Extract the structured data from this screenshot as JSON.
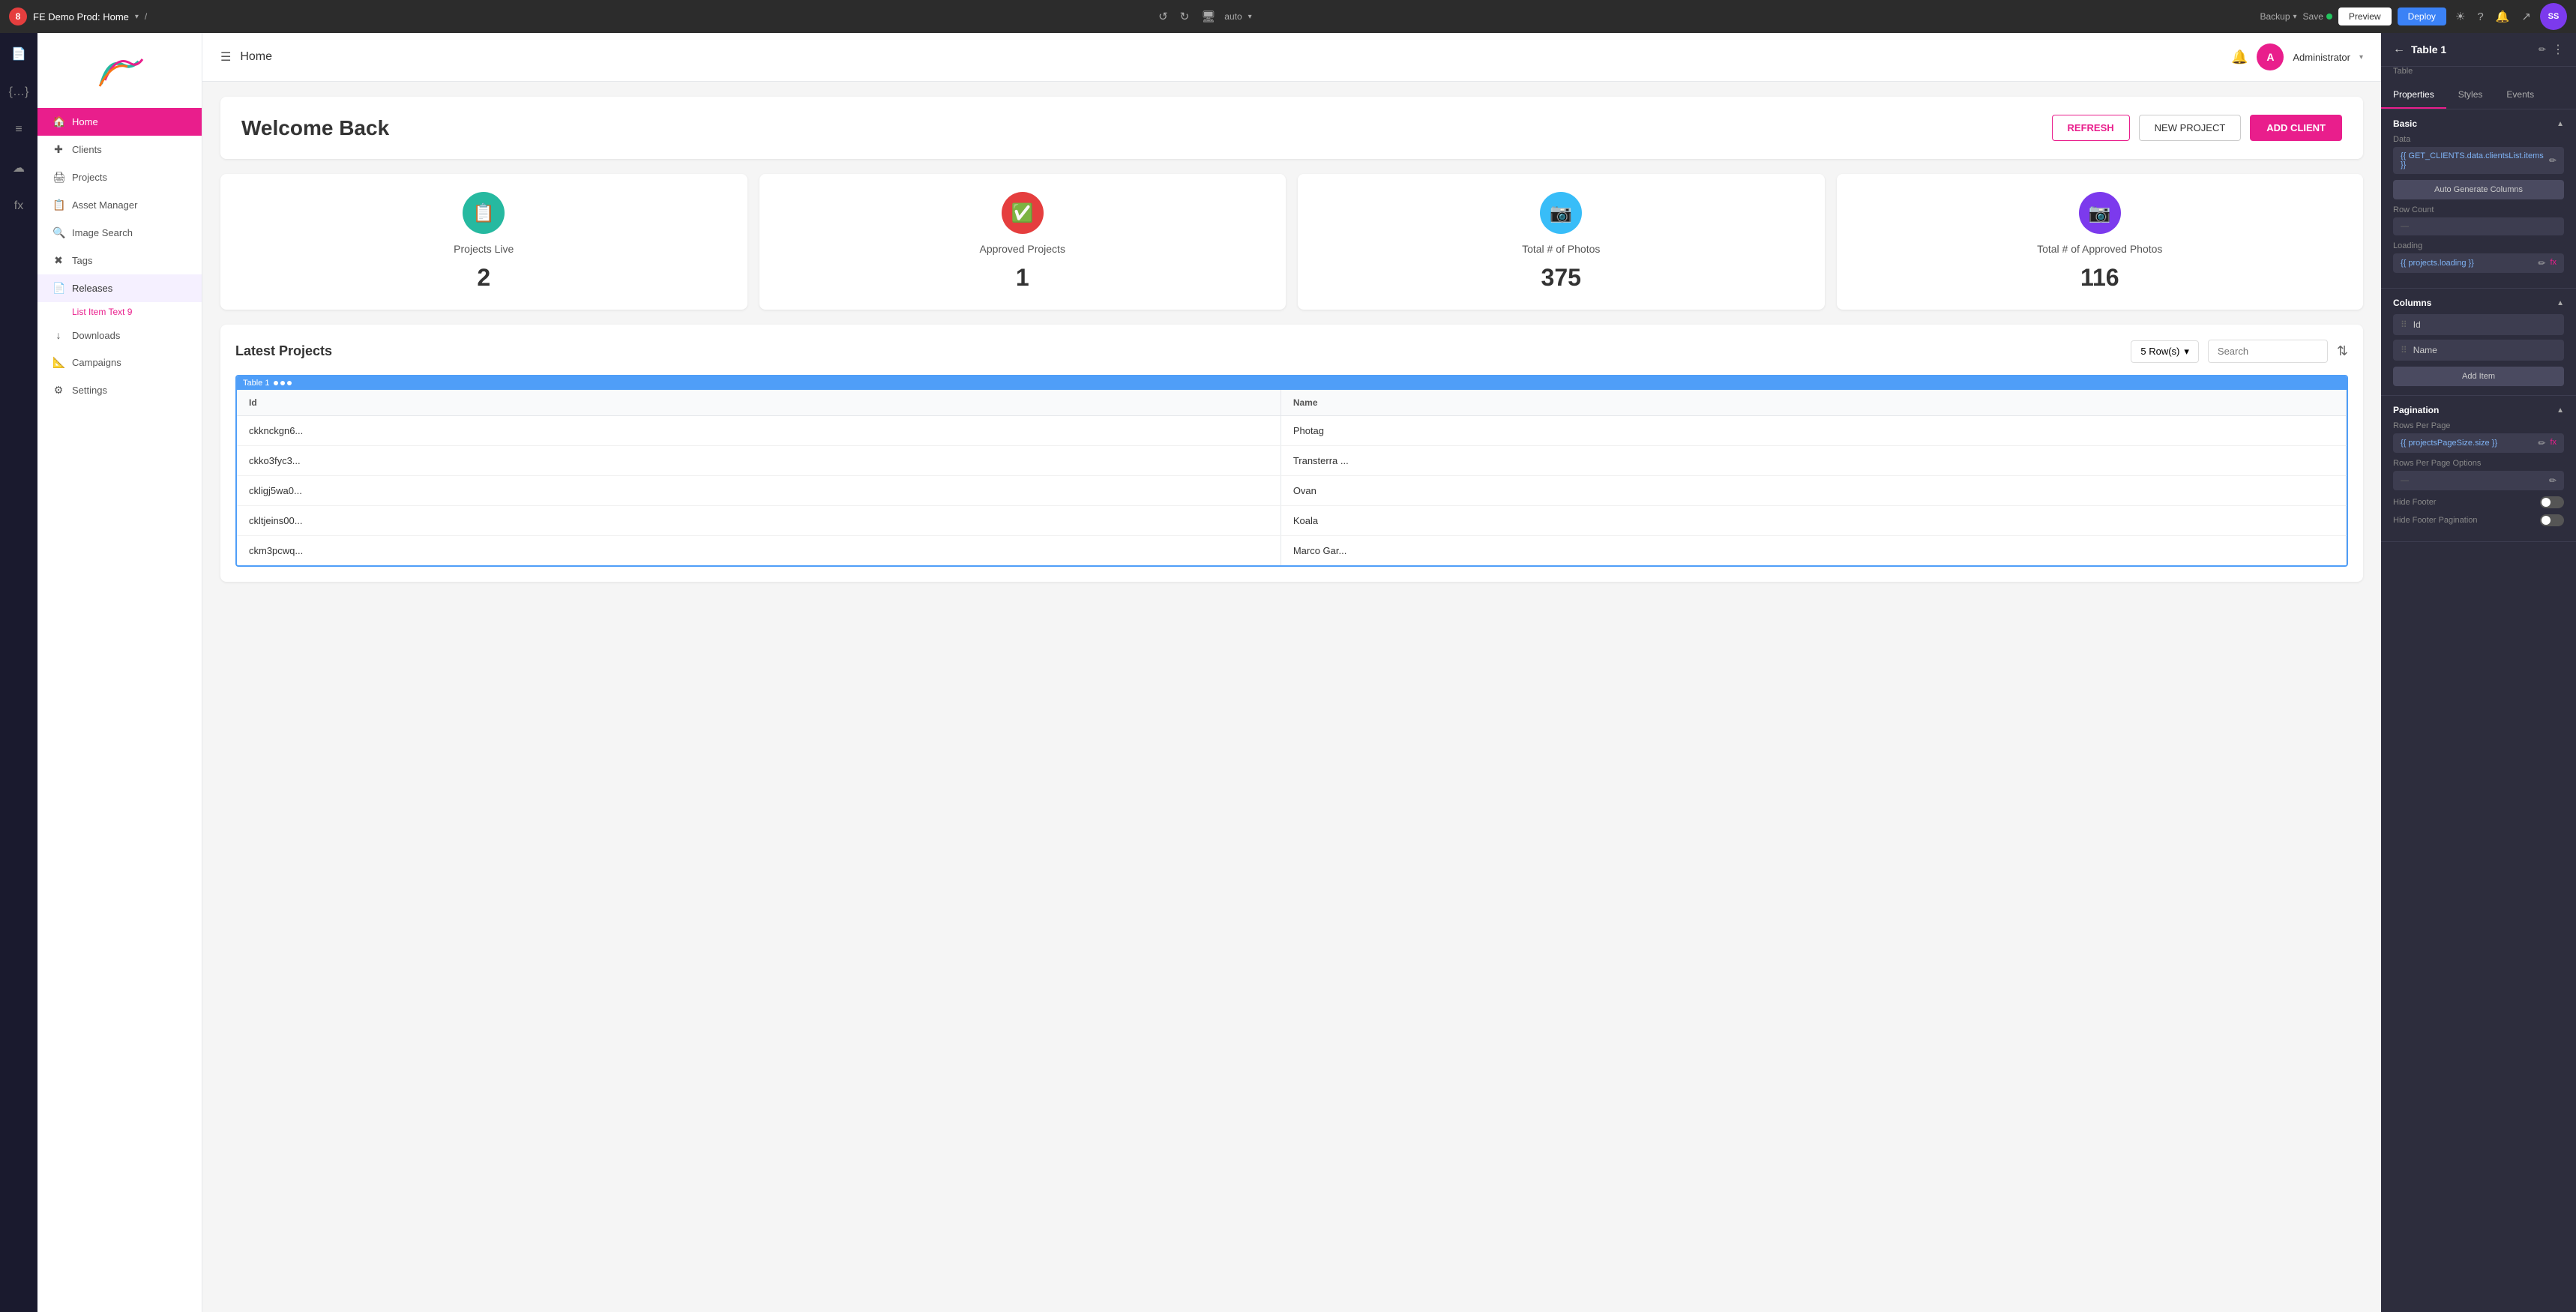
{
  "topbar": {
    "app_badge": "8",
    "project_name": "FE Demo Prod: Home",
    "breadcrumb": "/",
    "device_mode": "auto",
    "save_label": "Save",
    "backup_label": "Backup",
    "preview_label": "Preview",
    "deploy_label": "Deploy"
  },
  "nav": {
    "logo_text": "🦅",
    "items": [
      {
        "id": "home",
        "label": "Home",
        "icon": "🏠",
        "active": true
      },
      {
        "id": "clients",
        "label": "Clients",
        "icon": "+"
      },
      {
        "id": "projects",
        "label": "Projects",
        "icon": "🖨"
      },
      {
        "id": "asset-manager",
        "label": "Asset Manager",
        "icon": "📋"
      },
      {
        "id": "image-search",
        "label": "Image Search",
        "icon": "🔍"
      },
      {
        "id": "tags",
        "label": "Tags",
        "icon": "✖"
      },
      {
        "id": "releases",
        "label": "Releases",
        "icon": "📄",
        "selected": true
      },
      {
        "id": "downloads",
        "label": "Downloads",
        "icon": "↓"
      },
      {
        "id": "campaigns",
        "label": "Campaigns",
        "icon": "📐"
      },
      {
        "id": "settings",
        "label": "Settings",
        "icon": "⚙"
      }
    ],
    "subitem": "List Item Text 9"
  },
  "page_header": {
    "title": "Home",
    "admin_label": "Administrator"
  },
  "welcome": {
    "text": "Welcome Back",
    "refresh_label": "REFRESH",
    "new_project_label": "NEW PROJECT",
    "add_client_label": "ADD CLIENT"
  },
  "stats": [
    {
      "id": "projects-live",
      "label": "Projects Live",
      "value": "2",
      "color": "#26b9a0",
      "icon": "📋"
    },
    {
      "id": "approved-projects",
      "label": "Approved Projects",
      "value": "1",
      "color": "#e53e3e",
      "icon": "✅"
    },
    {
      "id": "total-photos",
      "label": "Total # of Photos",
      "value": "375",
      "color": "#38bdf8",
      "icon": "📷"
    },
    {
      "id": "total-approved-photos",
      "label": "Total # of Approved Photos",
      "value": "116",
      "color": "#7c3aed",
      "icon": "📷"
    }
  ],
  "projects_table": {
    "title": "Latest Projects",
    "row_select": "5 Row(s)",
    "search_placeholder": "Search",
    "table_label": "Table 1",
    "columns": [
      {
        "id": "id",
        "label": "Id"
      },
      {
        "id": "name",
        "label": "Name"
      }
    ],
    "rows": [
      {
        "id": "ckknckgn6...",
        "name": "Photag"
      },
      {
        "id": "ckko3fyc3...",
        "name": "Transterra ..."
      },
      {
        "id": "ckligj5wa0...",
        "name": "Ovan"
      },
      {
        "id": "ckltjeins00...",
        "name": "Koala"
      },
      {
        "id": "ckm3pcwq...",
        "name": "Marco Gar..."
      }
    ]
  },
  "right_panel": {
    "title": "Table 1",
    "subtitle": "Table",
    "tabs": [
      "Properties",
      "Styles",
      "Events"
    ],
    "active_tab": "Properties",
    "sections": {
      "basic": {
        "title": "Basic",
        "data_label": "Data",
        "data_value": "{{ GET_CLIENTS.data.clientsList.items }}",
        "auto_generate_label": "Auto Generate Columns",
        "row_count_label": "Row Count",
        "loading_label": "Loading",
        "loading_value": "{{ projects.loading }}"
      },
      "columns": {
        "title": "Columns",
        "items": [
          "Id",
          "Name"
        ],
        "add_item_label": "Add Item"
      },
      "pagination": {
        "title": "Pagination",
        "rows_per_page_label": "Rows Per Page",
        "rows_per_page_value": "{{ projectsPageSize.size }}",
        "rows_per_page_options_label": "Rows Per Page Options",
        "hide_footer_label": "Hide Footer",
        "hide_footer_pagination_label": "Hide Footer Pagination"
      }
    }
  }
}
